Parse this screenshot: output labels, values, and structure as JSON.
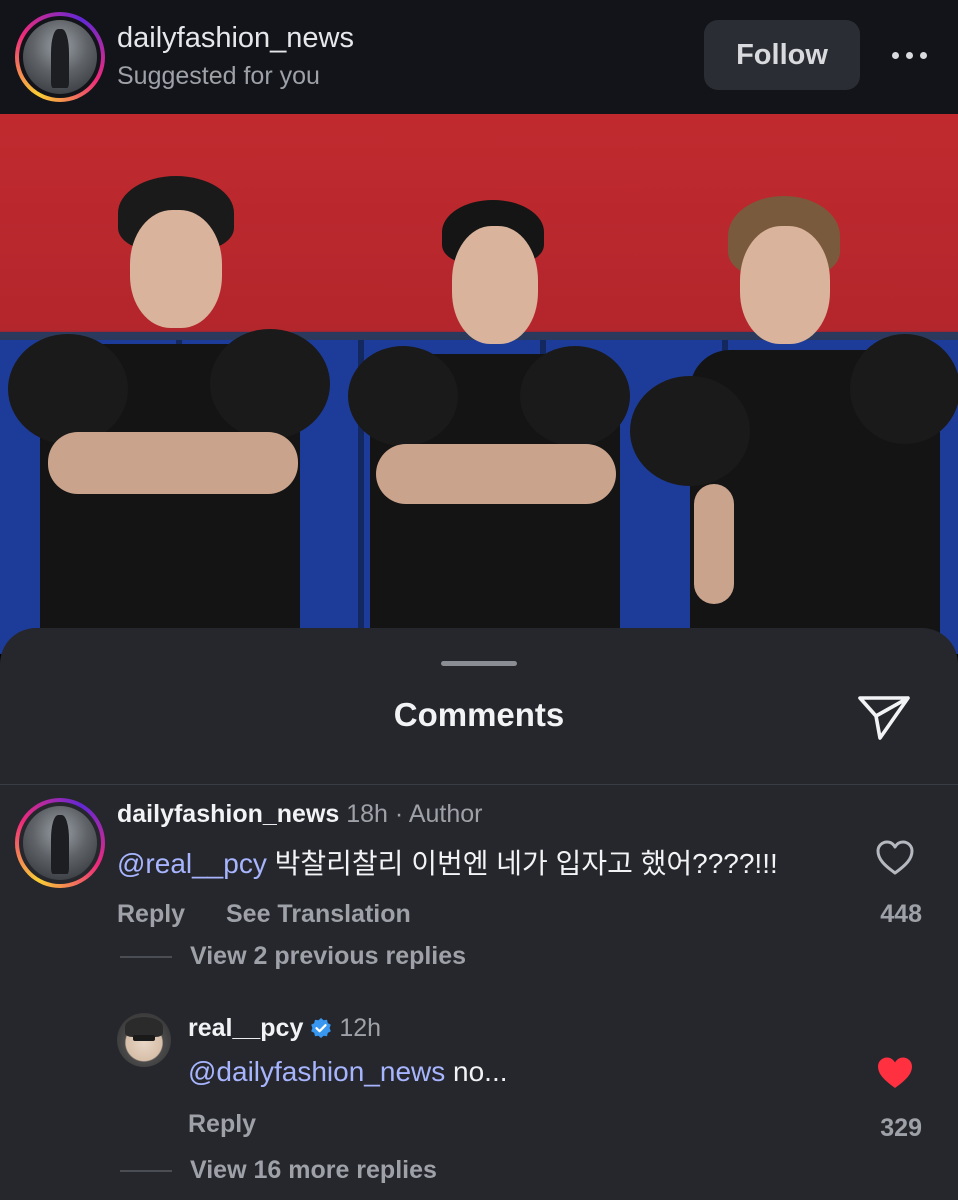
{
  "header": {
    "username": "dailyfashion_news",
    "subtitle": "Suggested for you",
    "follow_label": "Follow",
    "more_icon": "more-horizontal-icon"
  },
  "sheet": {
    "title": "Comments",
    "share_icon": "send-icon"
  },
  "comment": {
    "username": "dailyfashion_news",
    "time": "18h",
    "separator": "·",
    "role": "Author",
    "mention": "@real__pcy",
    "text": " 박찰리찰리 이번엔 네가 입자고 했어????!!!",
    "reply_label": "Reply",
    "translate_label": "See Translation",
    "likes": "448",
    "view_replies": "View 2 previous replies"
  },
  "reply": {
    "username": "real__pcy",
    "verified": true,
    "time": "12h",
    "mention": "@dailyfashion_news",
    "text": " no...",
    "reply_label": "Reply",
    "likes": "329",
    "liked": true,
    "heart_color": "#ff3040",
    "view_more": "View 16 more replies"
  },
  "colors": {
    "background": "#121419",
    "sheet": "#25272c",
    "mention": "#a7b5ff",
    "muted": "#9ea1a8",
    "verified": "#3897f0"
  }
}
